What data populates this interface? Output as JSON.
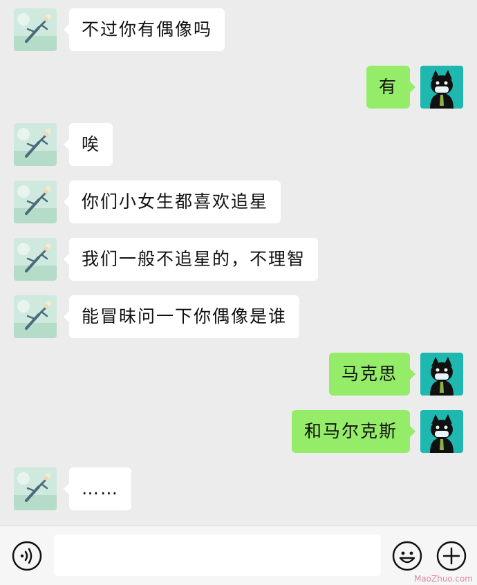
{
  "messages": [
    {
      "side": "left",
      "text": "不过你有偶像吗"
    },
    {
      "side": "right",
      "text": "有"
    },
    {
      "side": "left",
      "text": "唉"
    },
    {
      "side": "left",
      "text": "你们小女生都喜欢追星"
    },
    {
      "side": "left",
      "text": "我们一般不追星的，不理智"
    },
    {
      "side": "left",
      "text": "能冒昧问一下你偶像是谁"
    },
    {
      "side": "right",
      "text": "马克思"
    },
    {
      "side": "right",
      "text": "和马尔克斯"
    },
    {
      "side": "left",
      "text": "……"
    }
  ],
  "toolbar": {
    "input_placeholder": "",
    "icons": {
      "voice": "voice-input-icon",
      "emoji": "emoji-icon",
      "more": "plus-icon"
    }
  },
  "colors": {
    "chat_background": "#ececec",
    "incoming_bubble": "#ffffff",
    "outgoing_bubble": "#95ec69",
    "toolbar_background": "#f6f6f6"
  },
  "watermark": "MaoZhuo.com"
}
